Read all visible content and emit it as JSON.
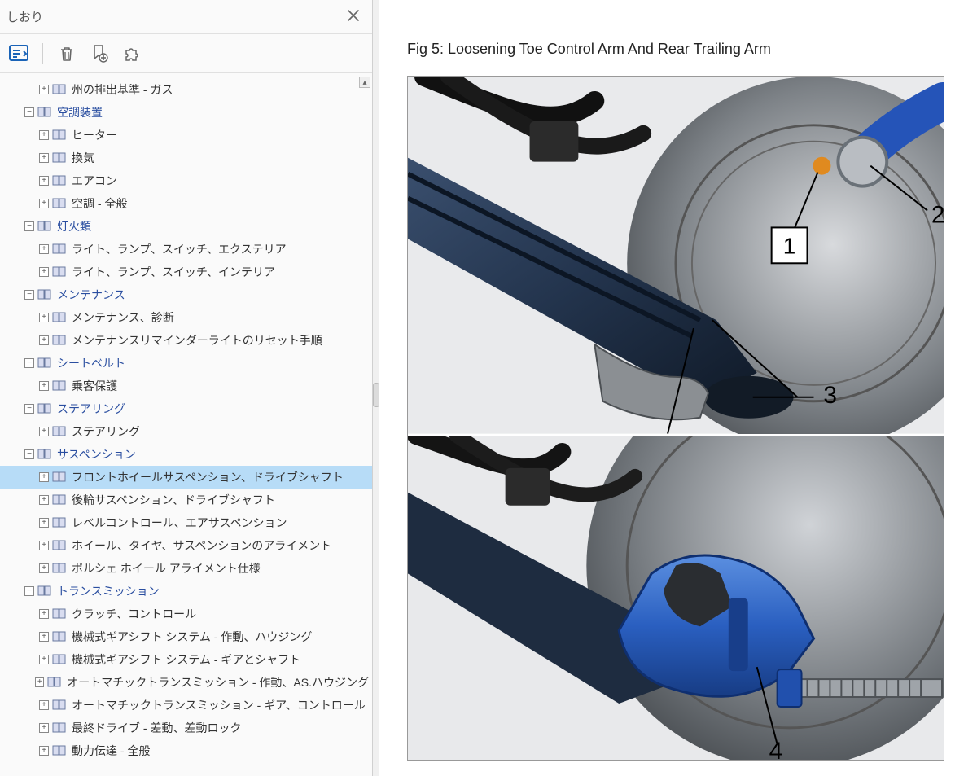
{
  "sidebar": {
    "title": "しおり",
    "tree": [
      {
        "level": 2,
        "exp": "+",
        "label": "州の排出基準 - ガス",
        "cat": false
      },
      {
        "level": 1,
        "exp": "-",
        "label": "空調装置",
        "cat": true
      },
      {
        "level": 2,
        "exp": "+",
        "label": "ヒーター",
        "cat": false
      },
      {
        "level": 2,
        "exp": "+",
        "label": "換気",
        "cat": false
      },
      {
        "level": 2,
        "exp": "+",
        "label": "エアコン",
        "cat": false
      },
      {
        "level": 2,
        "exp": "+",
        "label": "空調 - 全般",
        "cat": false
      },
      {
        "level": 1,
        "exp": "-",
        "label": "灯火類",
        "cat": true
      },
      {
        "level": 2,
        "exp": "+",
        "label": "ライト、ランプ、スイッチ、エクステリア",
        "cat": false
      },
      {
        "level": 2,
        "exp": "+",
        "label": "ライト、ランプ、スイッチ、インテリア",
        "cat": false
      },
      {
        "level": 1,
        "exp": "-",
        "label": "メンテナンス",
        "cat": true
      },
      {
        "level": 2,
        "exp": "+",
        "label": "メンテナンス、診断",
        "cat": false
      },
      {
        "level": 2,
        "exp": "+",
        "label": "メンテナンスリマインダーライトのリセット手順",
        "cat": false
      },
      {
        "level": 1,
        "exp": "-",
        "label": "シートベルト",
        "cat": true
      },
      {
        "level": 2,
        "exp": "+",
        "label": "乗客保護",
        "cat": false
      },
      {
        "level": 1,
        "exp": "-",
        "label": "ステアリング",
        "cat": true
      },
      {
        "level": 2,
        "exp": "+",
        "label": "ステアリング",
        "cat": false
      },
      {
        "level": 1,
        "exp": "-",
        "label": "サスペンション",
        "cat": true
      },
      {
        "level": 2,
        "exp": "+",
        "label": "フロントホイールサスペンション、ドライブシャフト",
        "cat": false,
        "selected": true
      },
      {
        "level": 2,
        "exp": "+",
        "label": "後輪サスペンション、ドライブシャフト",
        "cat": false
      },
      {
        "level": 2,
        "exp": "+",
        "label": "レベルコントロール、エアサスペンション",
        "cat": false
      },
      {
        "level": 2,
        "exp": "+",
        "label": "ホイール、タイヤ、サスペンションのアライメント",
        "cat": false
      },
      {
        "level": 2,
        "exp": "+",
        "label": "ポルシェ ホイール アライメント仕様",
        "cat": false
      },
      {
        "level": 1,
        "exp": "-",
        "label": "トランスミッション",
        "cat": true
      },
      {
        "level": 2,
        "exp": "+",
        "label": "クラッチ、コントロール",
        "cat": false
      },
      {
        "level": 2,
        "exp": "+",
        "label": "機械式ギアシフト システム - 作動、ハウジング",
        "cat": false
      },
      {
        "level": 2,
        "exp": "+",
        "label": "機械式ギアシフト システム - ギアとシャフト",
        "cat": false
      },
      {
        "level": 2,
        "exp": "+",
        "label": "オートマチックトランスミッション - 作動、AS.ハウジング",
        "cat": false
      },
      {
        "level": 2,
        "exp": "+",
        "label": "オートマチックトランスミッション - ギア、コントロール",
        "cat": false
      },
      {
        "level": 2,
        "exp": "+",
        "label": "最終ドライブ - 差動、差動ロック",
        "cat": false
      },
      {
        "level": 2,
        "exp": "+",
        "label": "動力伝達 - 全般",
        "cat": false
      }
    ]
  },
  "main": {
    "caption": "Fig 5: Loosening Toe Control Arm And Rear Trailing Arm",
    "callouts": {
      "a": "1",
      "b": "2",
      "c": "3",
      "d": "4"
    }
  }
}
